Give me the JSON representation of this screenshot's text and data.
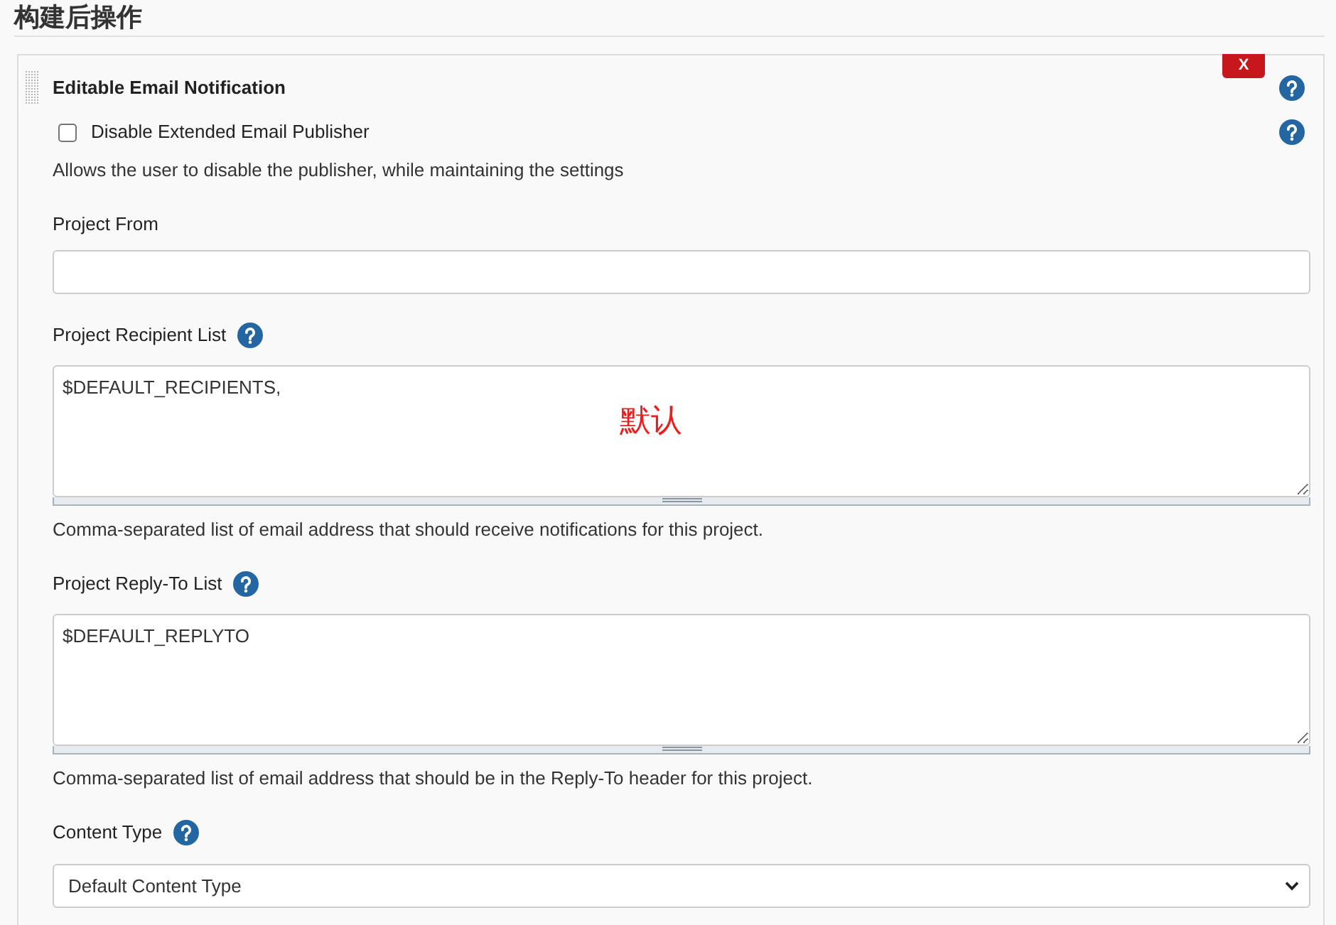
{
  "section_title": "构建后操作",
  "publisher": {
    "title": "Editable Email Notification",
    "delete_label": "X",
    "help": true,
    "fields": [
      {
        "kind": "checkbox",
        "label": "Disable Extended Email Publisher",
        "checked": false,
        "help": true,
        "description": "Allows the user to disable the publisher, while maintaining the settings"
      },
      {
        "kind": "text",
        "label": "Project From",
        "help": false
      },
      {
        "kind": "textarea",
        "label": "Project Recipient List",
        "help": true,
        "value": "$DEFAULT_RECIPIENTS,",
        "annotation": "默认",
        "description": "Comma-separated list of email address that should receive notifications for this project."
      },
      {
        "kind": "textarea",
        "label": "Project Reply-To List",
        "help": true,
        "value": "$DEFAULT_REPLYTO",
        "description": "Comma-separated list of email address that should be in the Reply-To header for this project."
      },
      {
        "kind": "select",
        "label": "Content Type",
        "help": true,
        "value": "Default Content Type"
      }
    ]
  }
}
